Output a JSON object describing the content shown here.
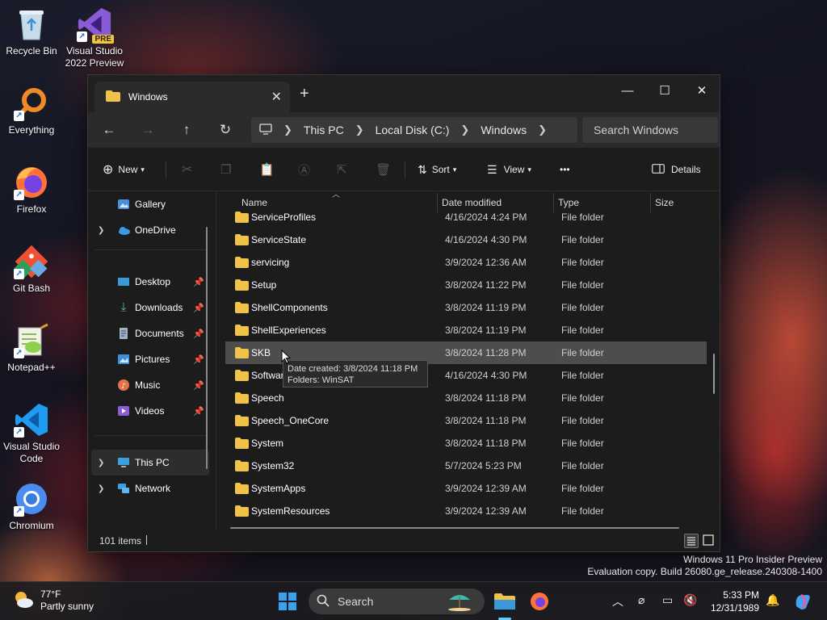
{
  "desktop": {
    "icons": [
      {
        "label": "Recycle Bin"
      },
      {
        "label": "Visual Studio 2022 Preview",
        "badge": "PRE"
      },
      {
        "label": "Everything"
      },
      {
        "label": "Firefox"
      },
      {
        "label": "Git Bash"
      },
      {
        "label": "Notepad++"
      },
      {
        "label": "Visual Studio Code"
      },
      {
        "label": "Chromium"
      }
    ],
    "watermark_line1": "Windows 11 Pro Insider Preview",
    "watermark_line2": "Evaluation copy. Build 26080.ge_release.240308-1400"
  },
  "window": {
    "tab_title": "Windows",
    "close_tab_glyph": "✕",
    "new_tab_glyph": "+",
    "controls": {
      "minimize": "—",
      "maximize": "☐",
      "close": "✕"
    },
    "breadcrumb": [
      "This PC",
      "Local Disk (C:)",
      "Windows"
    ],
    "search_placeholder": "Search Windows",
    "toolbar": {
      "new": "New",
      "sort": "Sort",
      "view": "View",
      "more": "•••",
      "details": "Details"
    },
    "sidebar": {
      "items": [
        {
          "label": "Gallery"
        },
        {
          "label": "OneDrive"
        },
        {
          "label": "Desktop"
        },
        {
          "label": "Downloads"
        },
        {
          "label": "Documents"
        },
        {
          "label": "Pictures"
        },
        {
          "label": "Music"
        },
        {
          "label": "Videos"
        },
        {
          "label": "This PC"
        },
        {
          "label": "Network"
        }
      ]
    },
    "columns": {
      "name": "Name",
      "date": "Date modified",
      "type": "Type",
      "size": "Size"
    },
    "rows": [
      {
        "name": "ServiceProfiles",
        "date": "4/16/2024 4:24 PM",
        "type": "File folder"
      },
      {
        "name": "ServiceState",
        "date": "4/16/2024 4:30 PM",
        "type": "File folder"
      },
      {
        "name": "servicing",
        "date": "3/9/2024 12:36 AM",
        "type": "File folder"
      },
      {
        "name": "Setup",
        "date": "3/8/2024 11:22 PM",
        "type": "File folder"
      },
      {
        "name": "ShellComponents",
        "date": "3/8/2024 11:19 PM",
        "type": "File folder"
      },
      {
        "name": "ShellExperiences",
        "date": "3/8/2024 11:19 PM",
        "type": "File folder"
      },
      {
        "name": "SKB",
        "date": "3/8/2024 11:28 PM",
        "type": "File folder"
      },
      {
        "name": "Software",
        "date": "4/16/2024 4:30 PM",
        "type": "File folder"
      },
      {
        "name": "Speech",
        "date": "3/8/2024 11:18 PM",
        "type": "File folder"
      },
      {
        "name": "Speech_OneCore",
        "date": "3/8/2024 11:18 PM",
        "type": "File folder"
      },
      {
        "name": "System",
        "date": "3/8/2024 11:18 PM",
        "type": "File folder"
      },
      {
        "name": "System32",
        "date": "5/7/2024 5:23 PM",
        "type": "File folder"
      },
      {
        "name": "SystemApps",
        "date": "3/9/2024 12:39 AM",
        "type": "File folder"
      },
      {
        "name": "SystemResources",
        "date": "3/9/2024 12:39 AM",
        "type": "File folder"
      }
    ],
    "tooltip_line1": "Date created: 3/8/2024 11:18 PM",
    "tooltip_line2": "Folders: WinSAT",
    "status_count": "101 items"
  },
  "taskbar": {
    "weather_temp": "77°F",
    "weather_desc": "Partly sunny",
    "search_label": "Search",
    "time": "5:33 PM",
    "date": "12/31/1989"
  },
  "colors": {
    "folder": "#f0c24a",
    "accent": "#60cdff",
    "hover_row": "#4d4d4d"
  }
}
